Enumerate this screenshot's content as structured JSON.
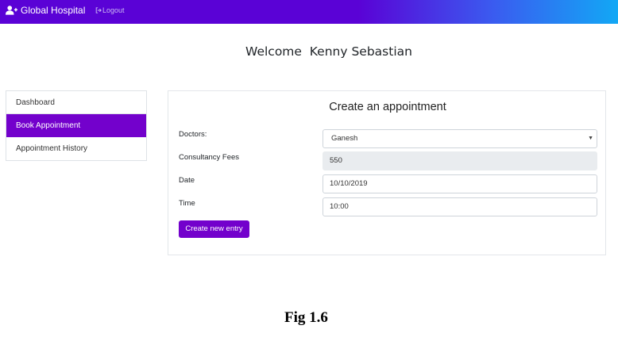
{
  "navbar": {
    "brand": "Global Hospital",
    "brand_icon": "user-plus-icon",
    "logout_label": "Logout",
    "logout_icon": "sign-out-icon",
    "gradient_colors": [
      "#5a02d6",
      "#3a5cf0",
      "#12a8f5"
    ]
  },
  "welcome": {
    "text": "Welcome  Kenny Sebastian"
  },
  "sidebar": {
    "items": [
      {
        "label": "Dashboard",
        "active": false
      },
      {
        "label": "Book Appointment",
        "active": true
      },
      {
        "label": "Appointment History",
        "active": false
      }
    ],
    "active_color": "#7301cc"
  },
  "form": {
    "title": "Create an appointment",
    "doctor_label": "Doctors:",
    "doctor_value": "Ganesh",
    "fees_label": "Consultancy Fees",
    "fees_value": "550",
    "date_label": "Date",
    "date_value": "10/10/2019",
    "time_label": "Time",
    "time_value": "10:00",
    "submit_label": "Create new entry"
  },
  "caption": "Fig 1.6"
}
